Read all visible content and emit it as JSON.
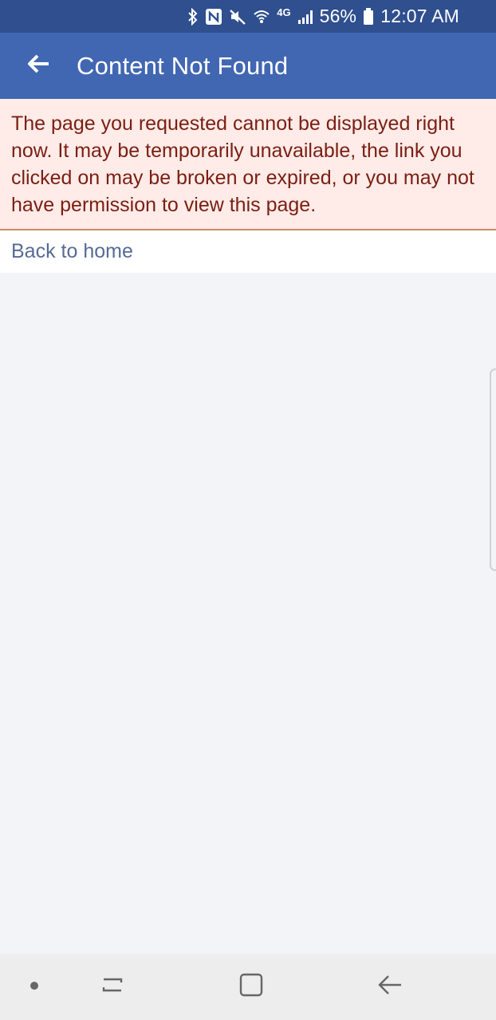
{
  "status_bar": {
    "icons": [
      "bluetooth-icon",
      "nfc-icon",
      "mute-icon",
      "wifi-icon",
      "lte-icon",
      "signal-icon",
      "battery-icon"
    ],
    "network_label": "4G",
    "battery": "56%",
    "time": "12:07 AM"
  },
  "app_bar": {
    "title": "Content Not Found",
    "back_icon": "arrow-left-icon"
  },
  "error": {
    "message": "The page you requested cannot be displayed right now. It may be temporarily unavailable, the link you clicked on may be broken or expired, or you may not have permission to view this page."
  },
  "home_link": {
    "label": "Back to home"
  },
  "nav_bar": {
    "icons": [
      "dot-icon",
      "recent-apps-icon",
      "home-icon",
      "back-icon"
    ]
  },
  "colors": {
    "status_bar": "#2f4f8f",
    "app_bar": "#4267b2",
    "error_bg": "#ffebe8",
    "error_text": "#7a1f12",
    "error_border": "#d4886a",
    "link": "#576b95",
    "page_bg": "#f3f4f7",
    "nav_bg": "#ededee"
  }
}
